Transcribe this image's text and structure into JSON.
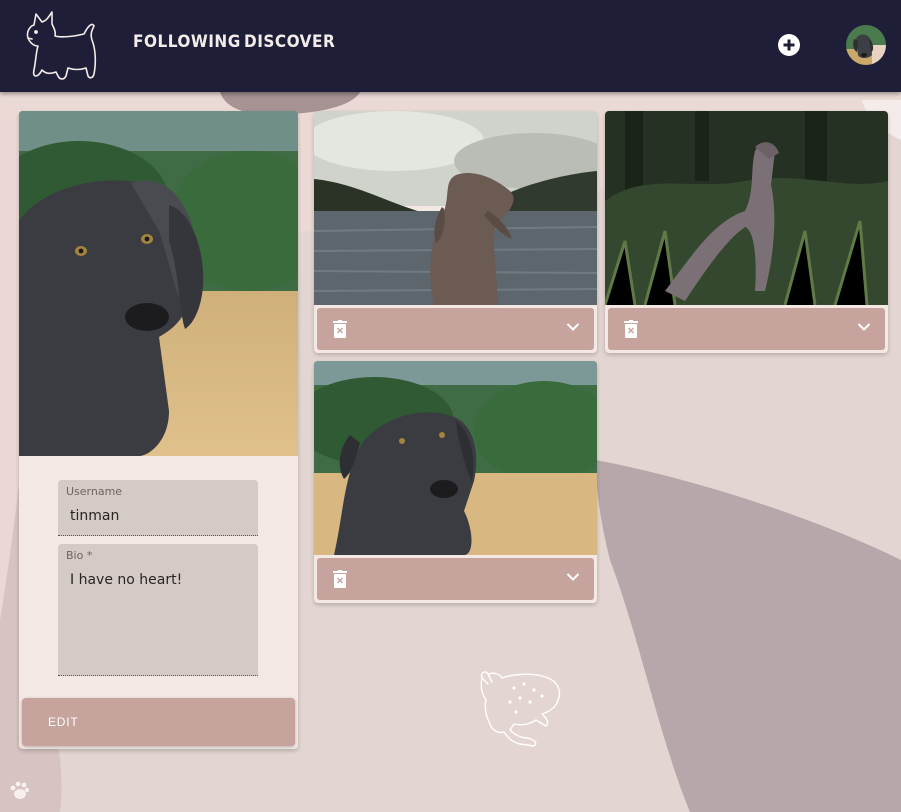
{
  "nav": {
    "logo": "dog-logo",
    "links": [
      "FOLLOWING",
      "DISCOVER"
    ],
    "add_icon": "plus-circle-icon",
    "avatar": "user-avatar"
  },
  "profile": {
    "username_label": "Username",
    "username_value": "tinman",
    "bio_label": "Bio *",
    "bio_value": "I have no heart!",
    "edit_label": "EDIT"
  },
  "posts": [
    {
      "image": "weimaraner-by-lake",
      "delete_icon": "trash-icon",
      "expand_icon": "chevron-down-icon"
    },
    {
      "image": "weimaraner-in-grass",
      "delete_icon": "trash-icon",
      "expand_icon": "chevron-down-icon"
    },
    {
      "image": "weimaraner-in-field",
      "delete_icon": "trash-icon",
      "expand_icon": "chevron-down-icon"
    }
  ],
  "decorations": [
    "frog-doodle",
    "paw-icon"
  ],
  "colors": {
    "topbar": "#1e1e38",
    "background": "#e3d6d2",
    "card": "#f3e8e4",
    "field": "#d4cac6",
    "accent": "#c6a39d"
  }
}
